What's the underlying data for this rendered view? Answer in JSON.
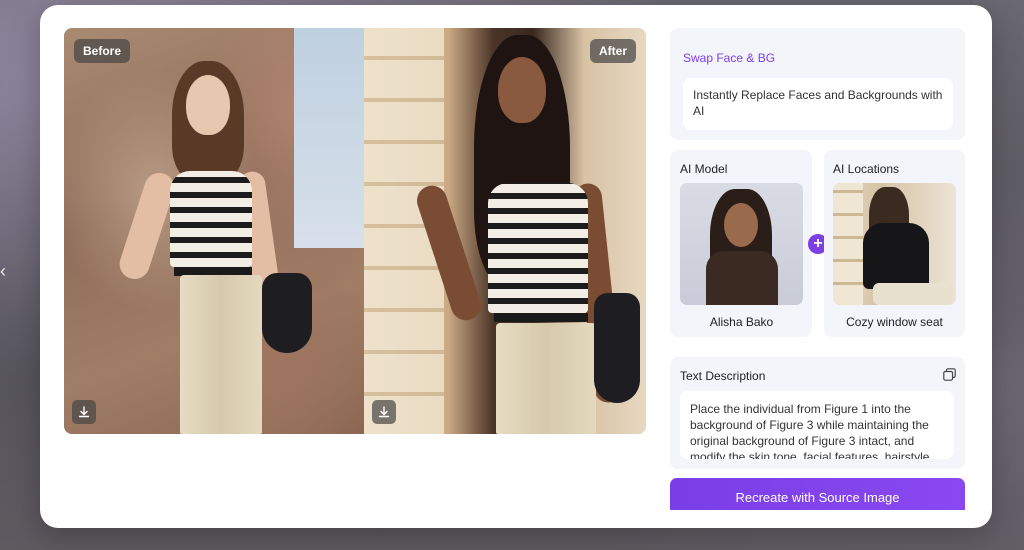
{
  "compare": {
    "before_label": "Before",
    "after_label": "After"
  },
  "panel": {
    "swap_title": "Swap Face & BG",
    "swap_description": "Instantly Replace Faces and Backgrounds with AI",
    "model_section_title": "AI Model",
    "model_name": "Alisha Bako",
    "location_section_title": "AI Locations",
    "location_name": "Cozy window seat",
    "plus_symbol": "+",
    "text_description_title": "Text Description",
    "text_description": "Place the individual from Figure 1 into the background of Figure 3 while maintaining the original background of Figure 3 intact, and modify the skin tone, facial features, hairstyle",
    "cta_label": "Recreate with Source Image"
  },
  "icons": {
    "download": "download-icon",
    "copy": "copy-icon",
    "plus": "plus-icon",
    "side_chevron": "chevron-left-icon"
  },
  "colors": {
    "accent": "#7b3fe4",
    "panel_bg": "#f4f4fb",
    "cta_bg": "#7a3ee6"
  }
}
